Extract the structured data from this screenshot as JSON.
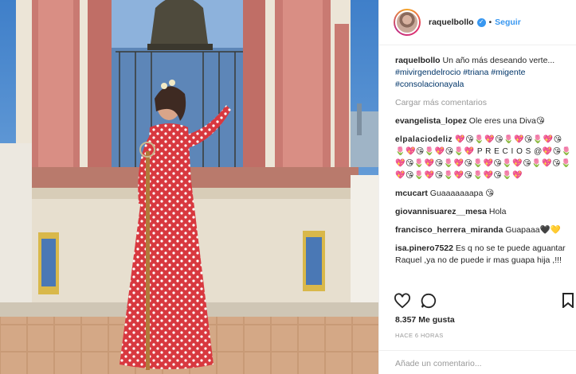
{
  "post": {
    "username": "raquelbollo",
    "follow_label": "Seguir",
    "dot": "•",
    "verified_glyph": "✓",
    "caption_user": "raquelbollo",
    "caption_text": " Un año más deseando verte...",
    "hashtags": [
      "#mivirgendelrocio",
      "#triana",
      "#migente",
      "#consolacionayala"
    ],
    "load_more": "Cargar más comentarios",
    "comments": [
      {
        "user": "evangelista_lopez",
        "text": " Ole eres una Diva😘"
      },
      {
        "user": "elpalaciodeliz",
        "text": " 💖😘🌷💖😘🌷💖😘🌷💖😘🌷💖😘🌷💖😘🌷💖 P R E C I O S @💖😘🌷💖😘🌷💖😘🌷💖😘🌷💖😘🌷💖😘🌷💖😘🌷💖😘🌷💖😘🌷💖😘🌷💖😘🌷💖"
      },
      {
        "user": "mcucart",
        "text": " Guaaaaaaapa 😘"
      },
      {
        "user": "giovannisuarez__mesa",
        "text": " Hola"
      },
      {
        "user": "francisco_herrera_miranda",
        "text": " Guapaaa🖤💛"
      },
      {
        "user": "isa.pinero7522",
        "text": " Es q no se te puede aguantar Raquel ,ya no de puede ir mas guapa hija ,!!!"
      }
    ],
    "likes": "8.357 Me gusta",
    "time": "HACE 6 HORAS",
    "add_comment_placeholder": "Añade un comentario..."
  },
  "icons": {
    "like": "heart-icon",
    "comment": "comment-icon",
    "save": "bookmark-icon",
    "verified": "verified-badge-icon"
  },
  "colors": {
    "link": "#3897f0",
    "hashtag": "#003569",
    "muted": "#999999",
    "text": "#262626"
  }
}
